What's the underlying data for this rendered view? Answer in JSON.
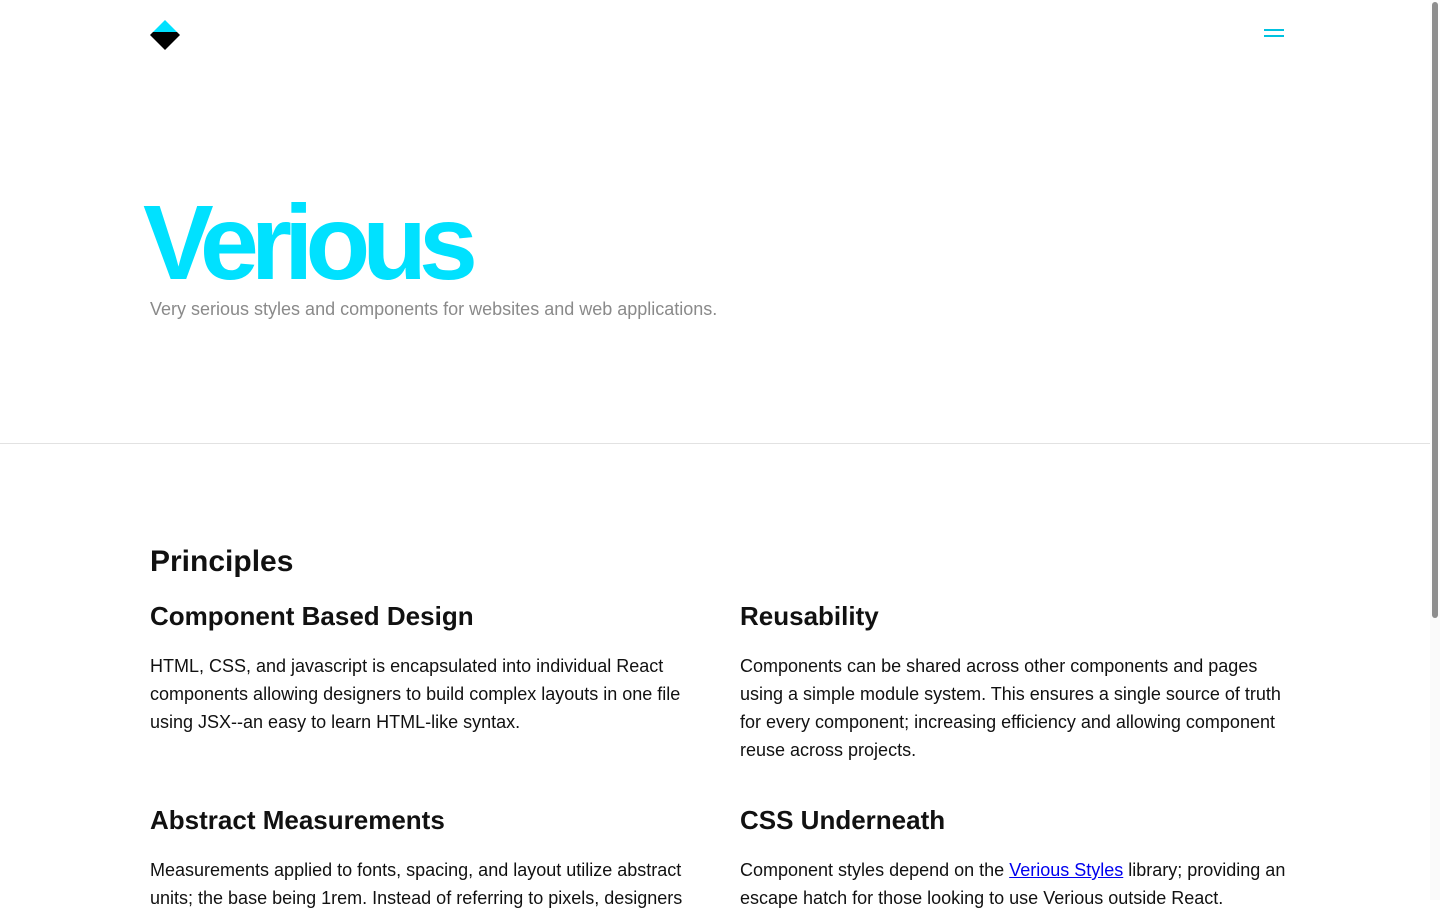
{
  "colors": {
    "accent": "#00e1ff",
    "menu": "#00c2e0",
    "logo_top": "#00e1ff",
    "logo_bottom": "#000000",
    "subtitle": "#8a8a8a",
    "link": "#0000ee"
  },
  "header": {
    "logo_icon": "diamond-logo-icon",
    "menu_icon": "hamburger-menu-icon"
  },
  "hero": {
    "title": "Verious",
    "subtitle": "Very serious styles and components for websites and web applications."
  },
  "principles": {
    "title": "Principles",
    "items": [
      {
        "title": "Component Based Design",
        "body": "HTML, CSS, and javascript is encapsulated into individual React components allowing designers to build complex layouts in one file using JSX--an easy to learn HTML-like syntax."
      },
      {
        "title": "Reusability",
        "body": "Components can be shared across other components and pages using a simple module system. This ensures a single source of truth for every component; increasing efficiency and allowing component reuse across projects."
      },
      {
        "title": "Abstract Measurements",
        "body": "Measurements applied to fonts, spacing, and layout utilize abstract units; the base being 1rem. Instead of referring to pixels, designers"
      },
      {
        "title": "CSS Underneath",
        "body_before": "Component styles depend on the ",
        "link_text": "Verious Styles",
        "body_after": " library; providing an escape hatch for those looking to use Verious outside React."
      }
    ]
  }
}
